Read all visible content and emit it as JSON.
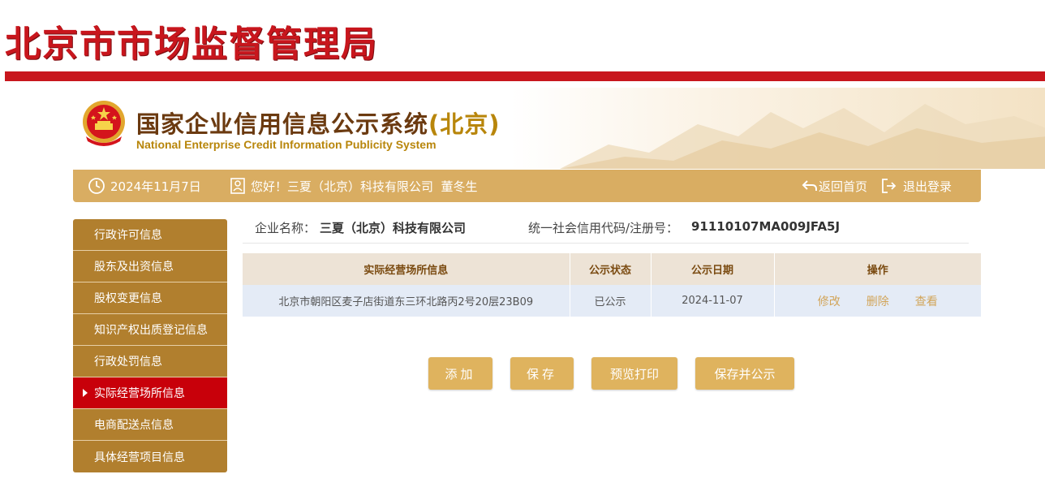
{
  "top_banner": {
    "title": "北京市市场监督管理局"
  },
  "system": {
    "title_cn": "国家企业信用信息公示系统",
    "title_region": "(北京)",
    "title_en": "National Enterprise Credit Information Publicity System"
  },
  "info_bar": {
    "date": "2024年11月7日",
    "greeting": "您好！三夏（北京）科技有限公司  董冬生",
    "back_home": "返回首页",
    "logout": "退出登录"
  },
  "side_nav": {
    "items": [
      {
        "label": "行政许可信息",
        "active": false
      },
      {
        "label": "股东及出资信息",
        "active": false
      },
      {
        "label": "股权变更信息",
        "active": false
      },
      {
        "label": "知识产权出质登记信息",
        "active": false
      },
      {
        "label": "行政处罚信息",
        "active": false
      },
      {
        "label": "实际经营场所信息",
        "active": true
      },
      {
        "label": "电商配送点信息",
        "active": false
      },
      {
        "label": "具体经营项目信息",
        "active": false
      }
    ]
  },
  "company": {
    "name_label": "企业名称：",
    "name_value": "三夏（北京）科技有限公司",
    "code_label": "统一社会信用代码/注册号：",
    "code_value": "91110107MA009JFA5J"
  },
  "table": {
    "headers": [
      "实际经营场所信息",
      "公示状态",
      "公示日期",
      "操作"
    ],
    "rows": [
      {
        "address": "北京市朝阳区麦子店街道东三环北路丙2号20层23B09",
        "status": "已公示",
        "date": "2024-11-07",
        "actions": [
          "修改",
          "删除",
          "查看"
        ]
      }
    ]
  },
  "buttons": {
    "add": "添加",
    "save": "保存",
    "preview_print": "预览打印",
    "save_publish": "保存并公示"
  },
  "colors": {
    "brand_red": "#c8161d",
    "gold_bar": "#d9ad62",
    "nav_brown": "#b17f2e",
    "nav_active": "#c8000a",
    "button_gold": "#dfb35e"
  }
}
